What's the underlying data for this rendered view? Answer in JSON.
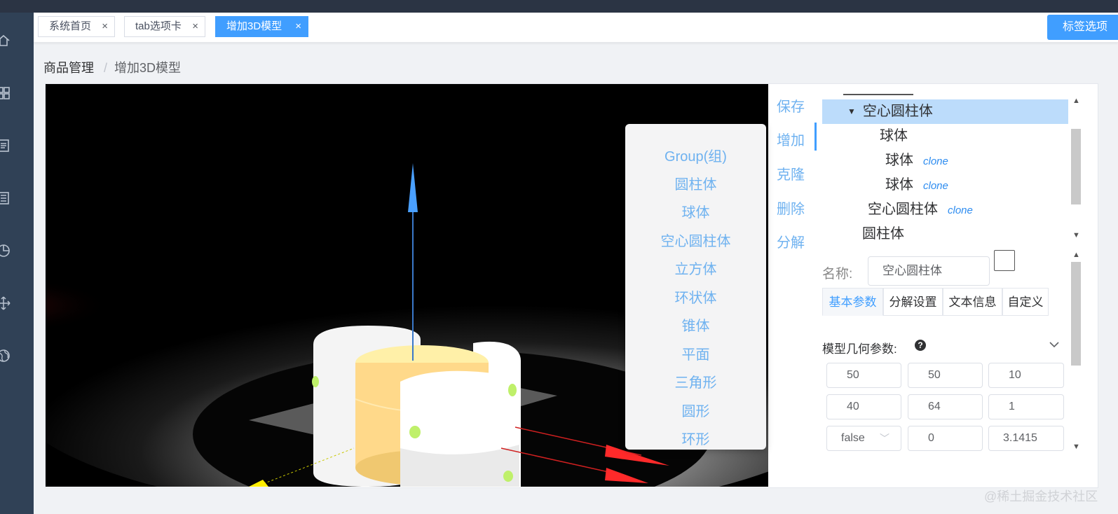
{
  "tabs": [
    {
      "label": "系统首页",
      "active": false
    },
    {
      "label": "tab选项卡",
      "active": false
    },
    {
      "label": "增加3D模型",
      "active": true
    }
  ],
  "tab_close_glyph": "×",
  "tag_button_label": "标签选项",
  "breadcrumb": {
    "root": "商品管理",
    "separator": "/",
    "current": "增加3D模型"
  },
  "sidebar_icons": [
    "home-icon",
    "grid-icon",
    "document-icon",
    "list-icon",
    "pie-chart-icon",
    "move-icon",
    "globe-icon"
  ],
  "add_menu": {
    "items": [
      "Group(组)",
      "圆柱体",
      "球体",
      "空心圆柱体",
      "立方体",
      "环状体",
      "锥体",
      "平面",
      "三角形",
      "圆形",
      "环形"
    ]
  },
  "actions": [
    "保存",
    "增加",
    "克隆",
    "删除",
    "分解"
  ],
  "active_action": "增加",
  "tree": {
    "rows": [
      {
        "label": "空心圆柱体",
        "clone": "",
        "selected": true,
        "expanded": true
      },
      {
        "label": "球体",
        "clone": "",
        "selected": false
      },
      {
        "label": "球体",
        "clone": "clone",
        "selected": false
      },
      {
        "label": "球体",
        "clone": "clone",
        "selected": false
      },
      {
        "label": "空心圆柱体",
        "clone": "clone",
        "selected": false
      },
      {
        "label": "圆柱体",
        "clone": "",
        "selected": false
      }
    ]
  },
  "props": {
    "name_label": "名称:",
    "name_value": "空心圆柱体",
    "subtabs": [
      "基本参数",
      "分解设置",
      "文本信息",
      "自定义"
    ],
    "active_subtab": "基本参数",
    "geometry_label": "模型几何参数:",
    "help_glyph": "?",
    "fields": [
      [
        "50",
        "50",
        "10"
      ],
      [
        "40",
        "64",
        "1"
      ],
      [
        "false",
        "0",
        "3.1415"
      ]
    ]
  },
  "colors": {
    "accent": "#409eff",
    "sidebar": "#304156",
    "menu_text": "#6fb2f0",
    "tree_selected": "#bcdcfb",
    "clone_text": "#2d8cf0"
  },
  "watermark": "@稀土掘金技术社区"
}
